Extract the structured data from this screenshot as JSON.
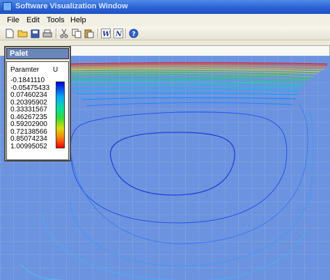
{
  "window": {
    "title": "Software Visualization Window"
  },
  "menu": {
    "items": [
      "File",
      "Edit",
      "Tools",
      "Help"
    ]
  },
  "toolbar": {
    "buttons": [
      "new-file-icon",
      "open-folder-icon",
      "save-icon",
      "print-icon",
      "cut-icon",
      "copy-icon",
      "paste-icon",
      "w-tool-icon",
      "n-tool-icon",
      "help-icon"
    ]
  },
  "palette": {
    "title": "Palet",
    "param_label": "Paramter",
    "variable": "U",
    "values": [
      "-0.1841110",
      "-0.05475433",
      "0.07460234",
      "0.20395902",
      "0.33331567",
      "0.46267235",
      "0.59202900",
      "0.72138566",
      "0.85074234",
      "1.00995052"
    ],
    "colors": [
      "#0000e0",
      "#00a8ff",
      "#00e0a0",
      "#30e030",
      "#d8e000",
      "#ff8000",
      "#ff0000"
    ]
  },
  "plot": {
    "background": "#6c93df",
    "grid_color": "#9fb6e6"
  }
}
